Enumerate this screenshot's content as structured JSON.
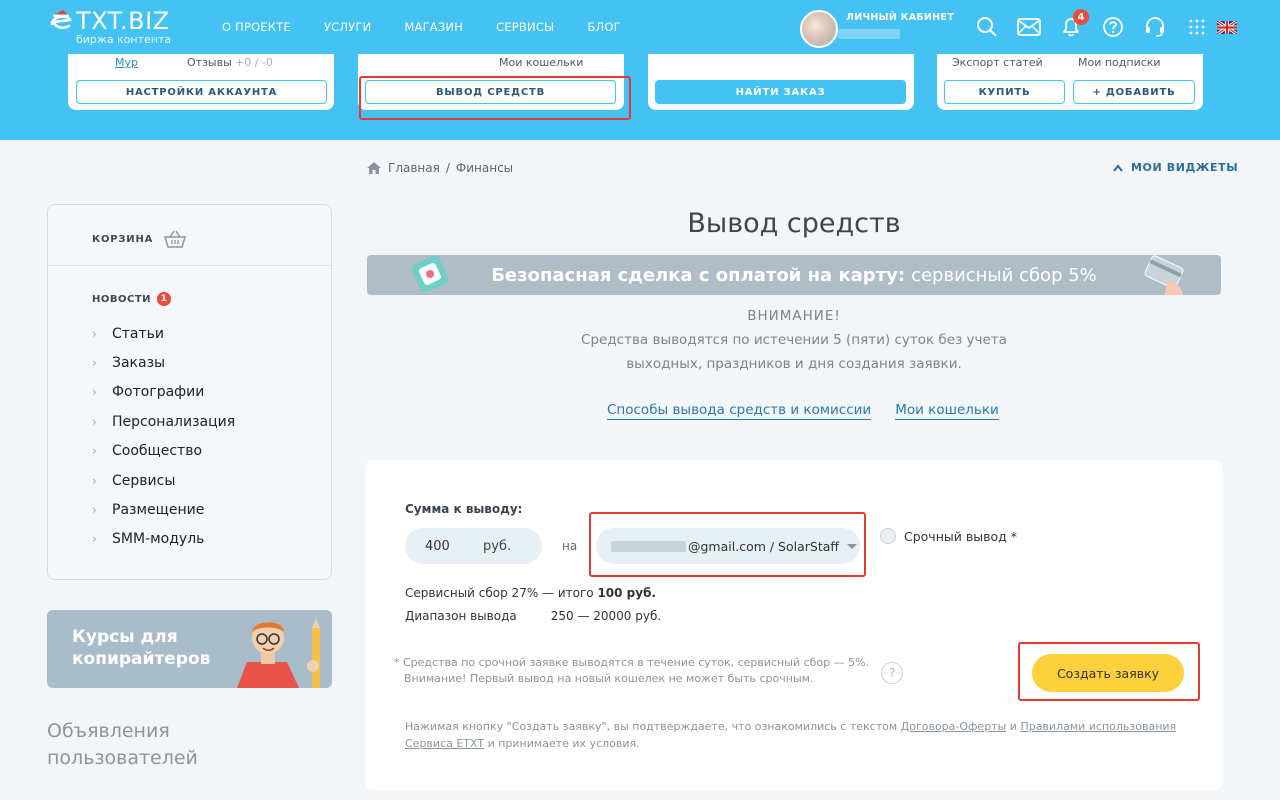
{
  "header": {
    "logo_text": "TXT.BIZ",
    "logo_sub": "биржа контента",
    "nav": [
      "О ПРОЕКТЕ",
      "УСЛУГИ",
      "МАГАЗИН",
      "СЕРВИСЫ",
      "БЛОГ"
    ],
    "user_label": "ЛИЧНЫЙ КАБИНЕТ",
    "notifications_count": "4",
    "icons": [
      "search-icon",
      "mail-icon",
      "bell-icon",
      "help-icon",
      "headset-icon",
      "grid-icon",
      "uk-flag-icon"
    ]
  },
  "cards": {
    "account": {
      "link": "Мур",
      "reviews_label": "Отзывы",
      "reviews_value": "+0 / -0",
      "button": "НАСТРОЙКИ АККАУНТА"
    },
    "withdraw": {
      "link": "Мои кошельки",
      "button": "ВЫВОД СРЕДСТВ"
    },
    "orders": {
      "button": "НАЙТИ ЗАКАЗ"
    },
    "shop": {
      "export": "Экспорт статей",
      "subs": "Мои подписки",
      "buy": "КУПИТЬ",
      "add": "+ ДОБАВИТЬ"
    }
  },
  "breadcrumb": {
    "home": "Главная",
    "sep": "/",
    "current": "Финансы"
  },
  "widgets_label": "МОИ ВИДЖЕТЫ",
  "sidebar": {
    "cart": "КОРЗИНА",
    "news": "НОВОСТИ",
    "news_count": "1",
    "items": [
      "Статьи",
      "Заказы",
      "Фотографии",
      "Персонализация",
      "Сообщество",
      "Сервисы",
      "Размещение",
      "SMM-модуль"
    ],
    "promo": "Курсы для копирайтеров",
    "ads_title": "Объявления пользователей"
  },
  "main": {
    "title": "Вывод средств",
    "banner_bold": "Безопасная сделка с оплатой на карту:",
    "banner_rest": "сервисный сбор 5%",
    "warn_title": "ВНИМАНИЕ!",
    "warn_line1": "Средства выводятся по истечении 5 (пяти) суток без учета",
    "warn_line2": "выходных, праздников и дня создания заявки.",
    "link_methods": "Способы вывода средств и комиссии",
    "link_wallets": "Мои кошельки"
  },
  "form": {
    "amount_label": "Сумма к выводу:",
    "amount_value": "400",
    "amount_unit": "руб.",
    "to_label": "на",
    "wallet_value": "@gmail.com / SolarStaff",
    "urgent_label": "Срочный вывод *",
    "fee_text": "Сервисный сбор 27% — итого ",
    "fee_total": "100 руб.",
    "range_label": "Диапазон вывода",
    "range_value": "250 — 20000 руб.",
    "note_line1": "* Средства по срочной заявке выводятся в течение суток, сервисный сбор — 5%.",
    "note_line2": "Внимание! Первый вывод на новый кошелек не может быть срочным.",
    "create_button": "Создать заявку",
    "terms_1": "Нажимая кнопку \"Создать заявку\", вы подтверждаете, что ознакомились с текстом ",
    "terms_link1": "Договора-Оферты",
    "terms_2": " и ",
    "terms_link2": "Правилами использования Сервиса ETXT",
    "terms_3": " и принимаете их условия."
  }
}
